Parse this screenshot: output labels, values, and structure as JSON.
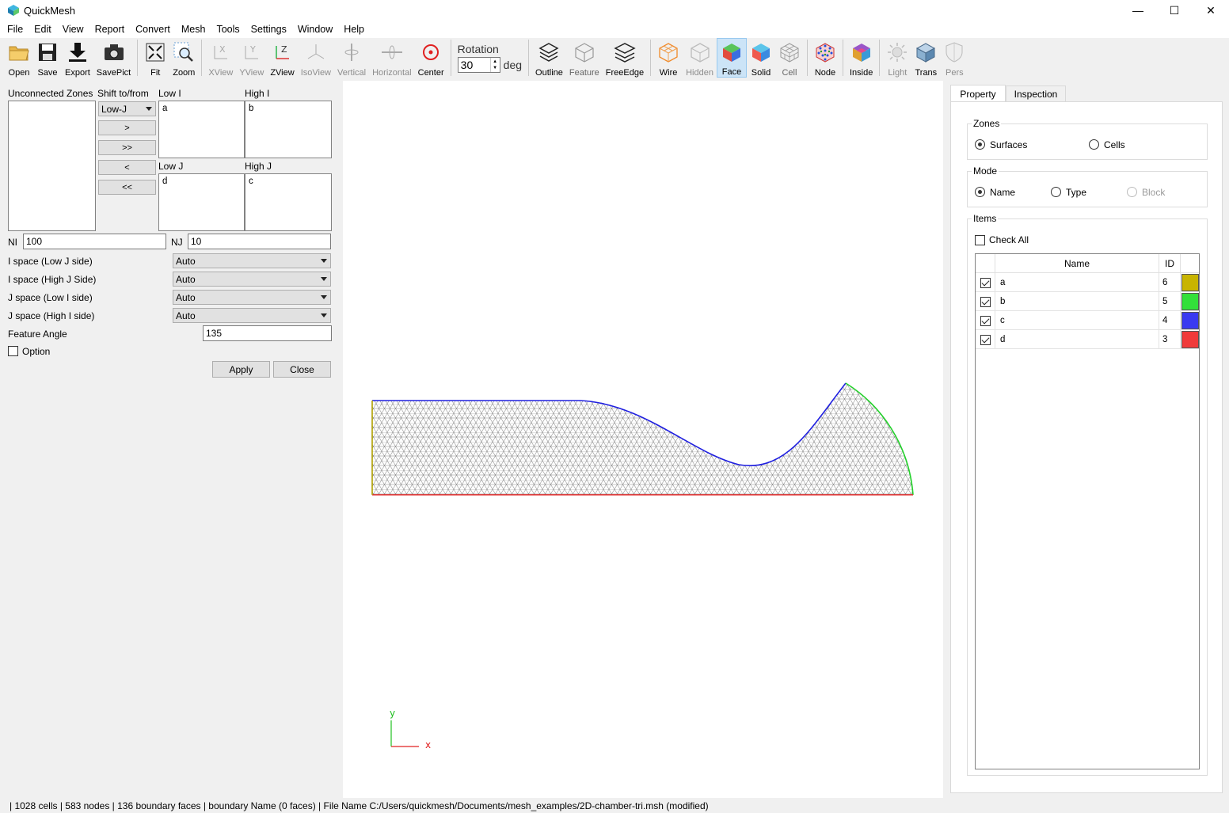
{
  "window": {
    "title": "QuickMesh",
    "minimize": "—",
    "maximize": "☐",
    "close": "✕"
  },
  "menu": [
    "File",
    "Edit",
    "View",
    "Report",
    "Convert",
    "Mesh",
    "Tools",
    "Settings",
    "Window",
    "Help"
  ],
  "toolbar": {
    "open": "Open",
    "save": "Save",
    "export": "Export",
    "savepict": "SavePict",
    "fit": "Fit",
    "zoom": "Zoom",
    "xview": "XView",
    "yview": "YView",
    "zview": "ZView",
    "isoview": "IsoView",
    "vertical": "Vertical",
    "horizontal": "Horizontal",
    "center": "Center",
    "rotation_label": "Rotation",
    "rotation_value": "30",
    "rotation_unit": "deg",
    "outline": "Outline",
    "feature": "Feature",
    "freeedge": "FreeEdge",
    "wire": "Wire",
    "hidden": "Hidden",
    "face": "Face",
    "solid": "Solid",
    "cell": "Cell",
    "node": "Node",
    "inside": "Inside",
    "light": "Light",
    "trans": "Trans",
    "pers": "Pers"
  },
  "left": {
    "unconnected_label": "Unconnected Zones",
    "shift_label": "Shift to/from",
    "shift_combo": "Low-J",
    "btn_right": ">",
    "btn_all_right": ">>",
    "btn_left": "<",
    "btn_all_left": "<<",
    "low_i_label": "Low I",
    "low_i_item": "a",
    "high_i_label": "High I",
    "high_i_item": "b",
    "low_j_label": "Low J",
    "low_j_item": "d",
    "high_j_label": "High J",
    "high_j_item": "c",
    "ni_label": "NI",
    "ni_value": "100",
    "nj_label": "NJ",
    "nj_value": "10",
    "ispace_low_label": "I space (Low J side)",
    "ispace_low_value": "Auto",
    "ispace_high_label": "I space (High J Side)",
    "ispace_high_value": "Auto",
    "jspace_low_label": "J space (Low I side)",
    "jspace_low_value": "Auto",
    "jspace_high_label": "J space (High I side)",
    "jspace_high_value": "Auto",
    "feature_angle_label": "Feature Angle",
    "feature_angle_value": "135",
    "option_label": "Option",
    "apply": "Apply",
    "close": "Close"
  },
  "viewport": {
    "axis_y": "y",
    "axis_x": "x"
  },
  "right": {
    "tab_property": "Property",
    "tab_inspection": "Inspection",
    "zones_title": "Zones",
    "zones_surfaces": "Surfaces",
    "zones_cells": "Cells",
    "mode_title": "Mode",
    "mode_name": "Name",
    "mode_type": "Type",
    "mode_block": "Block",
    "items_title": "Items",
    "check_all": "Check All",
    "col_name": "Name",
    "col_id": "ID",
    "rows": [
      {
        "name": "a",
        "id": "6",
        "color": "#c8b400"
      },
      {
        "name": "b",
        "id": "5",
        "color": "#33e03a"
      },
      {
        "name": "c",
        "id": "4",
        "color": "#3a3af0"
      },
      {
        "name": "d",
        "id": "3",
        "color": "#f03a3a"
      }
    ]
  },
  "status": "| 1028 cells | 583 nodes | 136 boundary faces |  boundary Name  (0 faces) | File Name C:/Users/quickmesh/Documents/mesh_examples/2D-chamber-tri.msh (modified)"
}
